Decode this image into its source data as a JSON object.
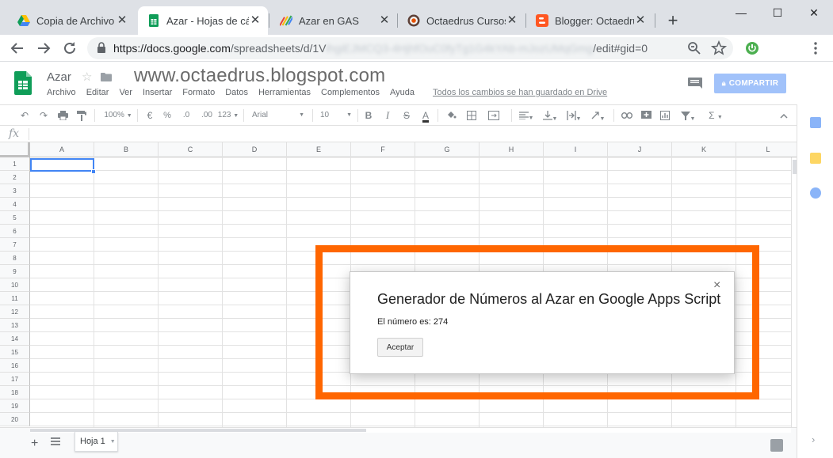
{
  "browser": {
    "tabs": [
      {
        "title": "Copia de Archivo -",
        "icon": "google-drive-icon",
        "active": false
      },
      {
        "title": "Azar - Hojas de cál",
        "icon": "google-sheets-icon",
        "active": true
      },
      {
        "title": "Azar en GAS",
        "icon": "pencil-art-icon",
        "active": false
      },
      {
        "title": "Octaedrus Cursos y",
        "icon": "octaedrus-logo-icon",
        "active": false
      },
      {
        "title": "Blogger: Octaedru",
        "icon": "blogger-icon",
        "active": false
      }
    ],
    "new_tab": "+",
    "url_domain": "https://docs.google.com",
    "url_path_start": "/spreadsheets/d/1V",
    "url_blurred": "lhgiEJMCQ3-4HjhfOuC0fyTg1G4kYAb-mJozUMqGmg",
    "url_path_end": "/edit#gid=0",
    "window_controls": {
      "minimize": "—",
      "maximize": "☐",
      "close": "✕"
    }
  },
  "sheets": {
    "doc_title": "Azar",
    "watermark": "www.octaedrus.blogspot.com",
    "menu": [
      "Archivo",
      "Editar",
      "Ver",
      "Insertar",
      "Formato",
      "Datos",
      "Herramientas",
      "Complementos",
      "Ayuda"
    ],
    "save_status": "Todos los cambios se han guardado en Drive",
    "share_label": "COMPARTIR",
    "toolbar": {
      "zoom": "100%",
      "currency": "€",
      "percent": "%",
      "decrease_decimals": ".0",
      "increase_decimals": ".00",
      "more_formats": "123",
      "font": "Arial",
      "font_size": "10",
      "bold": "B",
      "italic": "I",
      "strike": "S",
      "text_color": "A",
      "sigma": "Σ"
    },
    "fx": "fx",
    "columns": [
      "A",
      "B",
      "C",
      "D",
      "E",
      "F",
      "G",
      "H",
      "I",
      "J",
      "K",
      "L"
    ],
    "rows": [
      "1",
      "2",
      "3",
      "4",
      "5",
      "6",
      "7",
      "8",
      "9",
      "10",
      "11",
      "12",
      "13",
      "14",
      "15",
      "16",
      "17",
      "18",
      "19",
      "20"
    ],
    "sheet_tab": "Hoja 1"
  },
  "dialog": {
    "title": "Generador de Números al Azar en Google Apps Script",
    "message": "El número es: 274",
    "button": "Aceptar",
    "close": "×"
  },
  "colors": {
    "highlight": "#ff6600",
    "sheets_green": "#0f9d58",
    "share_button": "#a1c2fa",
    "selection": "#4285f4"
  }
}
